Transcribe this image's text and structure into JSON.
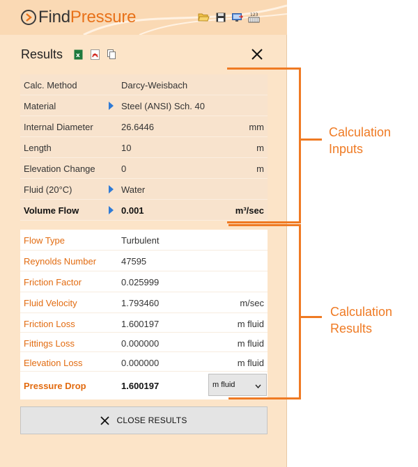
{
  "app": {
    "logo_find": "Find",
    "logo_pressure": "Pressure",
    "toolbar_icons": [
      "folder-open-icon",
      "save-icon",
      "send-to-screen-icon",
      "number-pad-icon"
    ]
  },
  "results_panel": {
    "title": "Results",
    "export_icons": [
      "excel-icon",
      "pdf-icon",
      "copy-icon"
    ]
  },
  "inputs": [
    {
      "label": "Calc. Method",
      "value": "Darcy-Weisbach",
      "unit": "",
      "has_arrow": false
    },
    {
      "label": "Material",
      "value": "Steel (ANSI) Sch.  40",
      "unit": "",
      "has_arrow": true
    },
    {
      "label": "Internal Diameter",
      "value": "26.6446",
      "unit": "mm",
      "has_arrow": false
    },
    {
      "label": "Length",
      "value": "10",
      "unit": "m",
      "has_arrow": false
    },
    {
      "label": "Elevation Change",
      "value": "0",
      "unit": "m",
      "has_arrow": false
    },
    {
      "label": "Fluid (20°C)",
      "value": "Water",
      "unit": "",
      "has_arrow": true
    },
    {
      "label": "Volume Flow",
      "value": "0.001",
      "unit": "m³/sec",
      "has_arrow": true,
      "bold": true
    }
  ],
  "results": [
    {
      "label": "Flow Type",
      "value": "Turbulent",
      "unit": ""
    },
    {
      "label": "Reynolds Number",
      "value": "47595",
      "unit": ""
    },
    {
      "label": "Friction Factor",
      "value": "0.025999",
      "unit": ""
    },
    {
      "label": "Fluid Velocity",
      "value": "1.793460",
      "unit": "m/sec"
    },
    {
      "label": "Friction Loss",
      "value": "1.600197",
      "unit": "m fluid"
    },
    {
      "label": "Fittings Loss",
      "value": "0.000000",
      "unit": "m fluid"
    },
    {
      "label": "Elevation Loss",
      "value": "0.000000",
      "unit": "m fluid"
    }
  ],
  "pressure_drop": {
    "label": "Pressure Drop",
    "value": "1.600197",
    "unit_selected": "m fluid"
  },
  "close_button": {
    "label": "CLOSE RESULTS"
  },
  "annotations": {
    "inputs_line1": "Calculation",
    "inputs_line2": "Inputs",
    "results_line1": "Calculation",
    "results_line2": "Results"
  },
  "colors": {
    "accent": "#e8721a",
    "arrow": "#2f7bd6",
    "annotation": "#ef7a23",
    "panel_bg": "#fce4c8"
  }
}
